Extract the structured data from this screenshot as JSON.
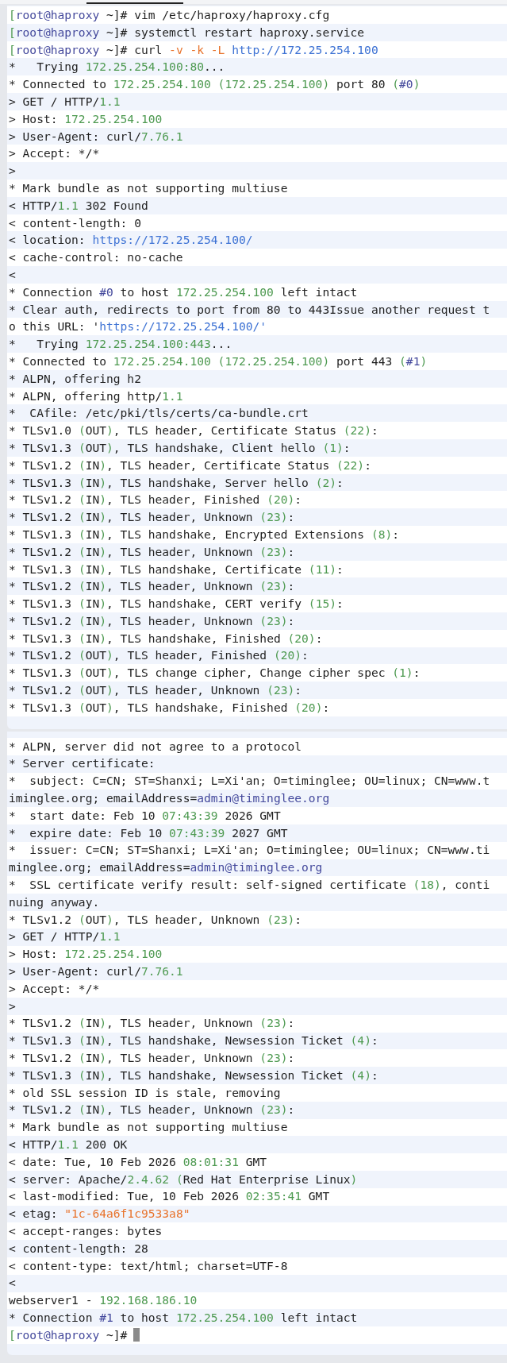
{
  "panels": [
    {
      "lines": [
        {
          "segs": [
            {
              "kind": "accent",
              "text": "["
            },
            {
              "kind": "ref",
              "text": "root@haproxy"
            },
            {
              "kind": "plain",
              "text": " ~]# vim /etc/haproxy/haproxy.cfg"
            }
          ]
        },
        {
          "segs": [
            {
              "kind": "accent",
              "text": "["
            },
            {
              "kind": "ref",
              "text": "root@haproxy"
            },
            {
              "kind": "plain",
              "text": " ~]# systemctl restart haproxy.service"
            }
          ]
        },
        {
          "segs": [
            {
              "kind": "accent",
              "text": "["
            },
            {
              "kind": "ref",
              "text": "root@haproxy"
            },
            {
              "kind": "plain",
              "text": " ~]# curl "
            },
            {
              "kind": "literal",
              "text": "-v -k -L "
            },
            {
              "kind": "url",
              "text": "http://172.25.254.100"
            }
          ]
        },
        {
          "segs": [
            {
              "kind": "plain",
              "text": "*   Trying "
            },
            {
              "kind": "accent",
              "text": "172.25.254.100:80"
            },
            {
              "kind": "plain",
              "text": "..."
            }
          ]
        },
        {
          "segs": [
            {
              "kind": "plain",
              "text": "* Connected to "
            },
            {
              "kind": "accent",
              "text": "172.25.254.100 (172.25.254.100)"
            },
            {
              "kind": "plain",
              "text": " port 80 "
            },
            {
              "kind": "accent",
              "text": "("
            },
            {
              "kind": "ref",
              "text": "#0"
            },
            {
              "kind": "accent",
              "text": ")"
            }
          ]
        },
        {
          "segs": [
            {
              "kind": "plain",
              "text": "> GET / HTTP/"
            },
            {
              "kind": "accent",
              "text": "1.1"
            }
          ]
        },
        {
          "segs": [
            {
              "kind": "plain",
              "text": "> Host: "
            },
            {
              "kind": "accent",
              "text": "172.25.254.100"
            }
          ]
        },
        {
          "segs": [
            {
              "kind": "plain",
              "text": "> User-Agent: curl/"
            },
            {
              "kind": "accent",
              "text": "7.76.1"
            }
          ]
        },
        {
          "segs": [
            {
              "kind": "plain",
              "text": "> Accept: */*"
            }
          ]
        },
        {
          "segs": [
            {
              "kind": "plain",
              "text": ">"
            }
          ]
        },
        {
          "segs": [
            {
              "kind": "plain",
              "text": "* Mark bundle as not supporting multiuse"
            }
          ]
        },
        {
          "segs": [
            {
              "kind": "plain",
              "text": "< HTTP/"
            },
            {
              "kind": "accent",
              "text": "1.1"
            },
            {
              "kind": "plain",
              "text": " 302 Found"
            }
          ]
        },
        {
          "segs": [
            {
              "kind": "plain",
              "text": "< content-length: 0"
            }
          ]
        },
        {
          "segs": [
            {
              "kind": "plain",
              "text": "< location: "
            },
            {
              "kind": "url",
              "text": "https://172.25.254.100/"
            }
          ]
        },
        {
          "segs": [
            {
              "kind": "plain",
              "text": "< cache-control: no-cache"
            }
          ]
        },
        {
          "segs": [
            {
              "kind": "plain",
              "text": "<"
            }
          ]
        },
        {
          "segs": [
            {
              "kind": "plain",
              "text": "* Connection "
            },
            {
              "kind": "ref",
              "text": "#0"
            },
            {
              "kind": "plain",
              "text": " to host "
            },
            {
              "kind": "accent",
              "text": "172.25.254.100"
            },
            {
              "kind": "plain",
              "text": " left intact"
            }
          ]
        },
        {
          "segs": [
            {
              "kind": "plain",
              "text": "* Clear auth, redirects to port from 80 to 443Issue another request t"
            }
          ]
        },
        {
          "segs": [
            {
              "kind": "plain",
              "text": "o this URL: '"
            },
            {
              "kind": "url",
              "text": "https://172.25.254.100/'"
            }
          ]
        },
        {
          "segs": [
            {
              "kind": "plain",
              "text": "*   Trying "
            },
            {
              "kind": "accent",
              "text": "172.25.254.100:443"
            },
            {
              "kind": "plain",
              "text": "..."
            }
          ]
        },
        {
          "segs": [
            {
              "kind": "plain",
              "text": "* Connected to "
            },
            {
              "kind": "accent",
              "text": "172.25.254.100 (172.25.254.100)"
            },
            {
              "kind": "plain",
              "text": " port 443 "
            },
            {
              "kind": "accent",
              "text": "("
            },
            {
              "kind": "ref",
              "text": "#1"
            },
            {
              "kind": "accent",
              "text": ")"
            }
          ]
        },
        {
          "segs": [
            {
              "kind": "plain",
              "text": "* ALPN, offering h2"
            }
          ]
        },
        {
          "segs": [
            {
              "kind": "plain",
              "text": "* ALPN, offering http/"
            },
            {
              "kind": "accent",
              "text": "1.1"
            }
          ]
        },
        {
          "segs": [
            {
              "kind": "plain",
              "text": "*  CAfile: /etc/pki/tls/certs/ca-bundle.crt"
            }
          ]
        },
        {
          "segs": [
            {
              "kind": "plain",
              "text": "* TLSv1.0 "
            },
            {
              "kind": "accent",
              "text": "("
            },
            {
              "kind": "plain",
              "text": "OUT"
            },
            {
              "kind": "accent",
              "text": ")"
            },
            {
              "kind": "plain",
              "text": ", TLS header, Certificate Status "
            },
            {
              "kind": "accent",
              "text": "(22)"
            },
            {
              "kind": "plain",
              "text": ":"
            }
          ]
        },
        {
          "segs": [
            {
              "kind": "plain",
              "text": "* TLSv1.3 "
            },
            {
              "kind": "accent",
              "text": "("
            },
            {
              "kind": "plain",
              "text": "OUT"
            },
            {
              "kind": "accent",
              "text": ")"
            },
            {
              "kind": "plain",
              "text": ", TLS handshake, Client hello "
            },
            {
              "kind": "accent",
              "text": "(1)"
            },
            {
              "kind": "plain",
              "text": ":"
            }
          ]
        },
        {
          "segs": [
            {
              "kind": "plain",
              "text": "* TLSv1.2 "
            },
            {
              "kind": "accent",
              "text": "("
            },
            {
              "kind": "plain",
              "text": "IN"
            },
            {
              "kind": "accent",
              "text": ")"
            },
            {
              "kind": "plain",
              "text": ", TLS header, Certificate Status "
            },
            {
              "kind": "accent",
              "text": "(22)"
            },
            {
              "kind": "plain",
              "text": ":"
            }
          ]
        },
        {
          "segs": [
            {
              "kind": "plain",
              "text": "* TLSv1.3 "
            },
            {
              "kind": "accent",
              "text": "("
            },
            {
              "kind": "plain",
              "text": "IN"
            },
            {
              "kind": "accent",
              "text": ")"
            },
            {
              "kind": "plain",
              "text": ", TLS handshake, Server hello "
            },
            {
              "kind": "accent",
              "text": "(2)"
            },
            {
              "kind": "plain",
              "text": ":"
            }
          ]
        },
        {
          "segs": [
            {
              "kind": "plain",
              "text": "* TLSv1.2 "
            },
            {
              "kind": "accent",
              "text": "("
            },
            {
              "kind": "plain",
              "text": "IN"
            },
            {
              "kind": "accent",
              "text": ")"
            },
            {
              "kind": "plain",
              "text": ", TLS header, Finished "
            },
            {
              "kind": "accent",
              "text": "(20)"
            },
            {
              "kind": "plain",
              "text": ":"
            }
          ]
        },
        {
          "segs": [
            {
              "kind": "plain",
              "text": "* TLSv1.2 "
            },
            {
              "kind": "accent",
              "text": "("
            },
            {
              "kind": "plain",
              "text": "IN"
            },
            {
              "kind": "accent",
              "text": ")"
            },
            {
              "kind": "plain",
              "text": ", TLS header, Unknown "
            },
            {
              "kind": "accent",
              "text": "(23)"
            },
            {
              "kind": "plain",
              "text": ":"
            }
          ]
        },
        {
          "segs": [
            {
              "kind": "plain",
              "text": "* TLSv1.3 "
            },
            {
              "kind": "accent",
              "text": "("
            },
            {
              "kind": "plain",
              "text": "IN"
            },
            {
              "kind": "accent",
              "text": ")"
            },
            {
              "kind": "plain",
              "text": ", TLS handshake, Encrypted Extensions "
            },
            {
              "kind": "accent",
              "text": "(8)"
            },
            {
              "kind": "plain",
              "text": ":"
            }
          ]
        },
        {
          "segs": [
            {
              "kind": "plain",
              "text": "* TLSv1.2 "
            },
            {
              "kind": "accent",
              "text": "("
            },
            {
              "kind": "plain",
              "text": "IN"
            },
            {
              "kind": "accent",
              "text": ")"
            },
            {
              "kind": "plain",
              "text": ", TLS header, Unknown "
            },
            {
              "kind": "accent",
              "text": "(23)"
            },
            {
              "kind": "plain",
              "text": ":"
            }
          ]
        },
        {
          "segs": [
            {
              "kind": "plain",
              "text": "* TLSv1.3 "
            },
            {
              "kind": "accent",
              "text": "("
            },
            {
              "kind": "plain",
              "text": "IN"
            },
            {
              "kind": "accent",
              "text": ")"
            },
            {
              "kind": "plain",
              "text": ", TLS handshake, Certificate "
            },
            {
              "kind": "accent",
              "text": "(11)"
            },
            {
              "kind": "plain",
              "text": ":"
            }
          ]
        },
        {
          "segs": [
            {
              "kind": "plain",
              "text": "* TLSv1.2 "
            },
            {
              "kind": "accent",
              "text": "("
            },
            {
              "kind": "plain",
              "text": "IN"
            },
            {
              "kind": "accent",
              "text": ")"
            },
            {
              "kind": "plain",
              "text": ", TLS header, Unknown "
            },
            {
              "kind": "accent",
              "text": "(23)"
            },
            {
              "kind": "plain",
              "text": ":"
            }
          ]
        },
        {
          "segs": [
            {
              "kind": "plain",
              "text": "* TLSv1.3 "
            },
            {
              "kind": "accent",
              "text": "("
            },
            {
              "kind": "plain",
              "text": "IN"
            },
            {
              "kind": "accent",
              "text": ")"
            },
            {
              "kind": "plain",
              "text": ", TLS handshake, CERT verify "
            },
            {
              "kind": "accent",
              "text": "(15)"
            },
            {
              "kind": "plain",
              "text": ":"
            }
          ]
        },
        {
          "segs": [
            {
              "kind": "plain",
              "text": "* TLSv1.2 "
            },
            {
              "kind": "accent",
              "text": "("
            },
            {
              "kind": "plain",
              "text": "IN"
            },
            {
              "kind": "accent",
              "text": ")"
            },
            {
              "kind": "plain",
              "text": ", TLS header, Unknown "
            },
            {
              "kind": "accent",
              "text": "(23)"
            },
            {
              "kind": "plain",
              "text": ":"
            }
          ]
        },
        {
          "segs": [
            {
              "kind": "plain",
              "text": "* TLSv1.3 "
            },
            {
              "kind": "accent",
              "text": "("
            },
            {
              "kind": "plain",
              "text": "IN"
            },
            {
              "kind": "accent",
              "text": ")"
            },
            {
              "kind": "plain",
              "text": ", TLS handshake, Finished "
            },
            {
              "kind": "accent",
              "text": "(20)"
            },
            {
              "kind": "plain",
              "text": ":"
            }
          ]
        },
        {
          "segs": [
            {
              "kind": "plain",
              "text": "* TLSv1.2 "
            },
            {
              "kind": "accent",
              "text": "("
            },
            {
              "kind": "plain",
              "text": "OUT"
            },
            {
              "kind": "accent",
              "text": ")"
            },
            {
              "kind": "plain",
              "text": ", TLS header, Finished "
            },
            {
              "kind": "accent",
              "text": "(20)"
            },
            {
              "kind": "plain",
              "text": ":"
            }
          ]
        },
        {
          "segs": [
            {
              "kind": "plain",
              "text": "* TLSv1.3 "
            },
            {
              "kind": "accent",
              "text": "("
            },
            {
              "kind": "plain",
              "text": "OUT"
            },
            {
              "kind": "accent",
              "text": ")"
            },
            {
              "kind": "plain",
              "text": ", TLS change cipher, Change cipher spec "
            },
            {
              "kind": "accent",
              "text": "(1)"
            },
            {
              "kind": "plain",
              "text": ":"
            }
          ]
        },
        {
          "segs": [
            {
              "kind": "plain",
              "text": "* TLSv1.2 "
            },
            {
              "kind": "accent",
              "text": "("
            },
            {
              "kind": "plain",
              "text": "OUT"
            },
            {
              "kind": "accent",
              "text": ")"
            },
            {
              "kind": "plain",
              "text": ", TLS header, Unknown "
            },
            {
              "kind": "accent",
              "text": "(23)"
            },
            {
              "kind": "plain",
              "text": ":"
            }
          ]
        },
        {
          "segs": [
            {
              "kind": "plain",
              "text": "* TLSv1.3 "
            },
            {
              "kind": "accent",
              "text": "("
            },
            {
              "kind": "plain",
              "text": "OUT"
            },
            {
              "kind": "accent",
              "text": ")"
            },
            {
              "kind": "plain",
              "text": ", TLS handshake, Finished "
            },
            {
              "kind": "accent",
              "text": "(20)"
            },
            {
              "kind": "plain",
              "text": ":"
            }
          ]
        }
      ]
    },
    {
      "lines": [
        {
          "segs": [
            {
              "kind": "plain",
              "text": "* ALPN, server did not agree to a protocol"
            }
          ]
        },
        {
          "segs": [
            {
              "kind": "plain",
              "text": "* Server certificate:"
            }
          ]
        },
        {
          "segs": [
            {
              "kind": "plain",
              "text": "*  subject: C=CN; ST=Shanxi; L=Xi'an; O=timinglee; OU=linux; CN=www.t"
            }
          ]
        },
        {
          "segs": [
            {
              "kind": "plain",
              "text": "iminglee.org; emailAddress="
            },
            {
              "kind": "ref",
              "text": "admin@timinglee.org"
            }
          ]
        },
        {
          "segs": [
            {
              "kind": "plain",
              "text": "*  start date: Feb 10 "
            },
            {
              "kind": "accent",
              "text": "07:43:39"
            },
            {
              "kind": "plain",
              "text": " 2026 GMT"
            }
          ]
        },
        {
          "segs": [
            {
              "kind": "plain",
              "text": "*  expire date: Feb 10 "
            },
            {
              "kind": "accent",
              "text": "07:43:39"
            },
            {
              "kind": "plain",
              "text": " 2027 GMT"
            }
          ]
        },
        {
          "segs": [
            {
              "kind": "plain",
              "text": "*  issuer: C=CN; ST=Shanxi; L=Xi'an; O=timinglee; OU=linux; CN=www.ti"
            }
          ]
        },
        {
          "segs": [
            {
              "kind": "plain",
              "text": "minglee.org; emailAddress="
            },
            {
              "kind": "ref",
              "text": "admin@timinglee.org"
            }
          ]
        },
        {
          "segs": [
            {
              "kind": "plain",
              "text": "*  SSL certificate verify result: self-signed certificate "
            },
            {
              "kind": "accent",
              "text": "(18)"
            },
            {
              "kind": "plain",
              "text": ", conti"
            }
          ]
        },
        {
          "segs": [
            {
              "kind": "plain",
              "text": "nuing anyway."
            }
          ]
        },
        {
          "segs": [
            {
              "kind": "plain",
              "text": "* TLSv1.2 "
            },
            {
              "kind": "accent",
              "text": "("
            },
            {
              "kind": "plain",
              "text": "OUT"
            },
            {
              "kind": "accent",
              "text": ")"
            },
            {
              "kind": "plain",
              "text": ", TLS header, Unknown "
            },
            {
              "kind": "accent",
              "text": "(23)"
            },
            {
              "kind": "plain",
              "text": ":"
            }
          ]
        },
        {
          "segs": [
            {
              "kind": "plain",
              "text": "> GET / HTTP/"
            },
            {
              "kind": "accent",
              "text": "1.1"
            }
          ]
        },
        {
          "segs": [
            {
              "kind": "plain",
              "text": "> Host: "
            },
            {
              "kind": "accent",
              "text": "172.25.254.100"
            }
          ]
        },
        {
          "segs": [
            {
              "kind": "plain",
              "text": "> User-Agent: curl/"
            },
            {
              "kind": "accent",
              "text": "7.76.1"
            }
          ]
        },
        {
          "segs": [
            {
              "kind": "plain",
              "text": "> Accept: */*"
            }
          ]
        },
        {
          "segs": [
            {
              "kind": "plain",
              "text": ">"
            }
          ]
        },
        {
          "segs": [
            {
              "kind": "plain",
              "text": "* TLSv1.2 "
            },
            {
              "kind": "accent",
              "text": "("
            },
            {
              "kind": "plain",
              "text": "IN"
            },
            {
              "kind": "accent",
              "text": ")"
            },
            {
              "kind": "plain",
              "text": ", TLS header, Unknown "
            },
            {
              "kind": "accent",
              "text": "(23)"
            },
            {
              "kind": "plain",
              "text": ":"
            }
          ]
        },
        {
          "segs": [
            {
              "kind": "plain",
              "text": "* TLSv1.3 "
            },
            {
              "kind": "accent",
              "text": "("
            },
            {
              "kind": "plain",
              "text": "IN"
            },
            {
              "kind": "accent",
              "text": ")"
            },
            {
              "kind": "plain",
              "text": ", TLS handshake, Newsession Ticket "
            },
            {
              "kind": "accent",
              "text": "(4)"
            },
            {
              "kind": "plain",
              "text": ":"
            }
          ]
        },
        {
          "segs": [
            {
              "kind": "plain",
              "text": "* TLSv1.2 "
            },
            {
              "kind": "accent",
              "text": "("
            },
            {
              "kind": "plain",
              "text": "IN"
            },
            {
              "kind": "accent",
              "text": ")"
            },
            {
              "kind": "plain",
              "text": ", TLS header, Unknown "
            },
            {
              "kind": "accent",
              "text": "(23)"
            },
            {
              "kind": "plain",
              "text": ":"
            }
          ]
        },
        {
          "segs": [
            {
              "kind": "plain",
              "text": "* TLSv1.3 "
            },
            {
              "kind": "accent",
              "text": "("
            },
            {
              "kind": "plain",
              "text": "IN"
            },
            {
              "kind": "accent",
              "text": ")"
            },
            {
              "kind": "plain",
              "text": ", TLS handshake, Newsession Ticket "
            },
            {
              "kind": "accent",
              "text": "(4)"
            },
            {
              "kind": "plain",
              "text": ":"
            }
          ]
        },
        {
          "segs": [
            {
              "kind": "plain",
              "text": "* old SSL session ID is stale, removing"
            }
          ]
        },
        {
          "segs": [
            {
              "kind": "plain",
              "text": "* TLSv1.2 "
            },
            {
              "kind": "accent",
              "text": "("
            },
            {
              "kind": "plain",
              "text": "IN"
            },
            {
              "kind": "accent",
              "text": ")"
            },
            {
              "kind": "plain",
              "text": ", TLS header, Unknown "
            },
            {
              "kind": "accent",
              "text": "(23)"
            },
            {
              "kind": "plain",
              "text": ":"
            }
          ]
        },
        {
          "segs": [
            {
              "kind": "plain",
              "text": "* Mark bundle as not supporting multiuse"
            }
          ]
        },
        {
          "segs": [
            {
              "kind": "plain",
              "text": "< HTTP/"
            },
            {
              "kind": "accent",
              "text": "1.1"
            },
            {
              "kind": "plain",
              "text": " 200 OK"
            }
          ]
        },
        {
          "segs": [
            {
              "kind": "plain",
              "text": "< date: Tue, 10 Feb 2026 "
            },
            {
              "kind": "accent",
              "text": "08:01:31"
            },
            {
              "kind": "plain",
              "text": " GMT"
            }
          ]
        },
        {
          "segs": [
            {
              "kind": "plain",
              "text": "< server: Apache/"
            },
            {
              "kind": "accent",
              "text": "2.4.62 ("
            },
            {
              "kind": "plain",
              "text": "Red Hat Enterprise Linux"
            },
            {
              "kind": "accent",
              "text": ")"
            }
          ]
        },
        {
          "segs": [
            {
              "kind": "plain",
              "text": "< last-modified: Tue, 10 Feb 2026 "
            },
            {
              "kind": "accent",
              "text": "02:35:41"
            },
            {
              "kind": "plain",
              "text": " GMT"
            }
          ]
        },
        {
          "segs": [
            {
              "kind": "plain",
              "text": "< etag: "
            },
            {
              "kind": "literal",
              "text": "\"1c-64a6f1c9533a8\""
            }
          ]
        },
        {
          "segs": [
            {
              "kind": "plain",
              "text": "< accept-ranges: bytes"
            }
          ]
        },
        {
          "segs": [
            {
              "kind": "plain",
              "text": "< content-length: 28"
            }
          ]
        },
        {
          "segs": [
            {
              "kind": "plain",
              "text": "< content-type: text/html; charset=UTF-8"
            }
          ]
        },
        {
          "segs": [
            {
              "kind": "plain",
              "text": "<"
            }
          ]
        },
        {
          "segs": [
            {
              "kind": "plain",
              "text": "webserver1 - "
            },
            {
              "kind": "accent",
              "text": "192.168.186.10"
            }
          ]
        },
        {
          "segs": [
            {
              "kind": "plain",
              "text": "* Connection "
            },
            {
              "kind": "ref",
              "text": "#1"
            },
            {
              "kind": "plain",
              "text": " to host "
            },
            {
              "kind": "accent",
              "text": "172.25.254.100"
            },
            {
              "kind": "plain",
              "text": " left intact"
            }
          ]
        },
        {
          "segs": [
            {
              "kind": "accent",
              "text": "["
            },
            {
              "kind": "ref",
              "text": "root@haproxy"
            },
            {
              "kind": "plain",
              "text": " ~]#"
            }
          ],
          "cursor": true
        }
      ]
    }
  ]
}
